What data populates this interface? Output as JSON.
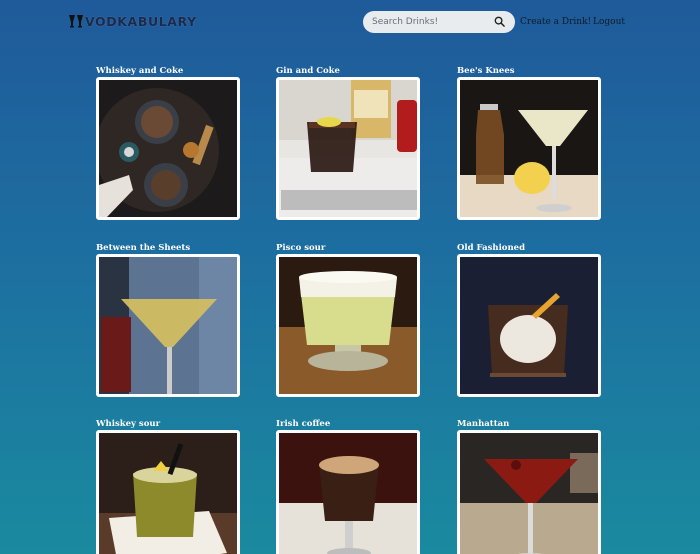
{
  "nav": {
    "logo_text": "VODKABULARY",
    "search_placeholder": "Search Drinks!",
    "create_label": "Create a Drink!",
    "logout_label": "Logout"
  },
  "drinks": [
    {
      "name": "Whiskey and Coke"
    },
    {
      "name": "Gin and Coke"
    },
    {
      "name": "Bee's Knees"
    },
    {
      "name": "Between the Sheets"
    },
    {
      "name": "Pisco sour"
    },
    {
      "name": "Old Fashioned"
    },
    {
      "name": "Whiskey sour"
    },
    {
      "name": "Irish coffee"
    },
    {
      "name": "Manhattan"
    }
  ],
  "colors": {
    "background_top": "#1f5a9a",
    "background_bottom": "#1a8a9f",
    "card_border": "#ffffff",
    "search_bg": "#e9ecef"
  },
  "icons": {
    "logo": "cocktail-glasses-icon",
    "search": "magnifier-icon"
  }
}
